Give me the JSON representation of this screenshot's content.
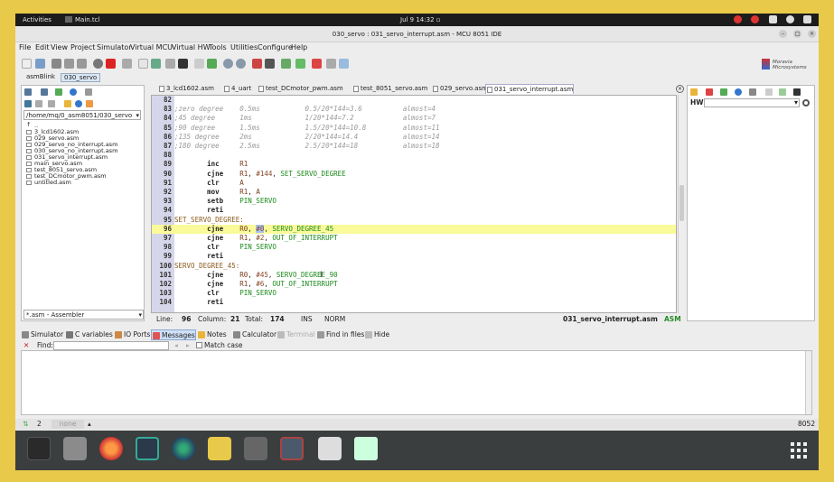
{
  "topbar": {
    "activities": "Activities",
    "app": "Main.tcl",
    "clock": "Jul 9  14:32"
  },
  "window": {
    "title": "030_servo : 031_servo_interrupt.asm - MCU 8051 IDE"
  },
  "menu": [
    "File",
    "Edit",
    "View",
    "Project",
    "Simulator",
    "Virtual MCU",
    "Virtual HW",
    "Tools",
    "Utilities",
    "Configure",
    "Help"
  ],
  "logo": {
    "line1": "Moravia",
    "line2": "Microsystems"
  },
  "project_tabs": [
    "asmBlink",
    "030_servo"
  ],
  "filebrowser": {
    "path": "/home/mq/0_asm8051/030_servo",
    "up": "..",
    "files": [
      "3_lcd1602.asm",
      "029_servo.asm",
      "029_servo_no_interrupt.asm",
      "030_servo_no_interrupt.asm",
      "031_servo_interrupt.asm",
      "main_servo.asm",
      "test_8051_servo.asm",
      "test_DCmotor_pwm.asm",
      "untitled.asm"
    ],
    "filter": "*.asm  - Assembler"
  },
  "editor_tabs": [
    "3_lcd1602.asm",
    "4_uart",
    "test_DCmotor_pwm.asm",
    "test_8051_servo.asm",
    "029_servo.asm",
    "031_servo_interrupt.asm"
  ],
  "code": [
    {
      "n": "82",
      "t": ""
    },
    {
      "n": "83",
      "t": ";zero degree    0.5ms           0.5/20*144=3.6          almost=4"
    },
    {
      "n": "84",
      "t": ";45 degree      1ms             1/20*144=7.2            almost=7"
    },
    {
      "n": "85",
      "t": ";90 degree      1.5ms           1.5/20*144=10.8         almost=11"
    },
    {
      "n": "86",
      "t": ";135 degree     2ms             2/20*144=14.4           almost=14"
    },
    {
      "n": "87",
      "t": ";180 degree     2.5ms           2.5/20*144=18           almost=18"
    },
    {
      "n": "88",
      "t": ""
    },
    {
      "n": "89",
      "t": "        inc     R1"
    },
    {
      "n": "90",
      "t": "        cjne    R1, #144, SET_SERVO_DEGREE"
    },
    {
      "n": "91",
      "t": "        clr     A"
    },
    {
      "n": "92",
      "t": "        mov     R1, A"
    },
    {
      "n": "93",
      "t": "        setb    PIN_SERVO"
    },
    {
      "n": "94",
      "t": "        reti"
    },
    {
      "n": "95",
      "t": "SET_SERVO_DEGREE:"
    },
    {
      "n": "96",
      "t": "        cjne    R0, #0, SERVO_DEGREE_45"
    },
    {
      "n": "97",
      "t": "        cjne    R1, #2, OUT_OF_INTERRUPT"
    },
    {
      "n": "98",
      "t": "        clr     PIN_SERVO"
    },
    {
      "n": "99",
      "t": "        reti"
    },
    {
      "n": "100",
      "t": "SERVO_DEGREE_45:"
    },
    {
      "n": "101",
      "t": "        cjne    R0, #45, SERVO_DEGREE_90"
    },
    {
      "n": "102",
      "t": "        cjne    R1, #6, OUT_OF_INTERRUPT"
    },
    {
      "n": "103",
      "t": "        clr     PIN_SERVO"
    },
    {
      "n": "104",
      "t": "        reti"
    }
  ],
  "status": {
    "line_label": "Line:",
    "line": "96",
    "col_label": "Column:",
    "col": "21",
    "total_label": "Total:",
    "total": "174",
    "ins": "INS",
    "norm": "NORM",
    "file": "031_servo_interrupt.asm",
    "lang": "ASM"
  },
  "right": {
    "hw_label": "HW:"
  },
  "bottom_tabs": [
    "Simulator",
    "C variables",
    "IO Ports",
    "Messages",
    "Notes",
    "Calculator",
    "Terminal",
    "Find in files",
    "Hide"
  ],
  "find": {
    "label": "Find:",
    "match_case": "Match case"
  },
  "bottom_status": {
    "num": "2",
    "none": "none",
    "code": "8052"
  },
  "colors": {
    "highlight": "#fafa9a",
    "gutter": "#d6d6ea",
    "dock": "#3a3e3f"
  }
}
